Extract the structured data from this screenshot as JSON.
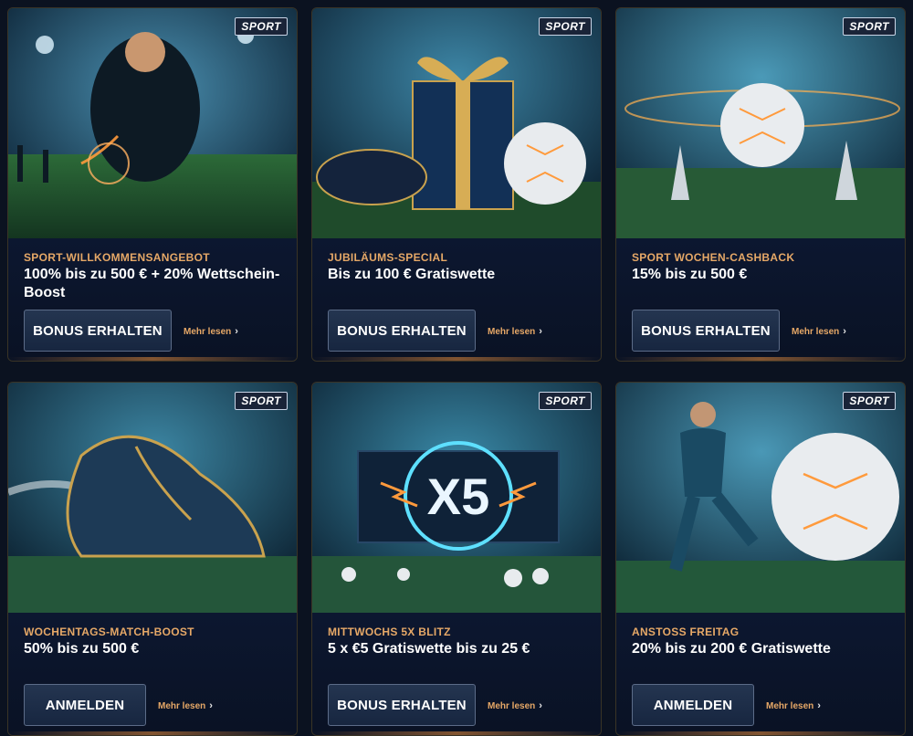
{
  "cards": [
    {
      "badge": "SPORT",
      "subtitle": "SPORT-WILLKOMMENSANGEBOT",
      "title": "100% bis zu 500 € + 20% Wettschein-Boost",
      "button": "BONUS ERHALTEN",
      "more": "Mehr lesen",
      "more_icon": "chevron-right-icon"
    },
    {
      "badge": "SPORT",
      "subtitle": "JUBILÄUMS-SPECIAL",
      "title": "Bis zu 100 € Gratiswette",
      "button": "BONUS ERHALTEN",
      "more": "Mehr lesen",
      "more_icon": "chevron-right-icon"
    },
    {
      "badge": "SPORT",
      "subtitle": "SPORT WOCHEN-CASHBACK",
      "title": "15% bis zu 500 €",
      "button": "BONUS ERHALTEN",
      "more": "Mehr lesen",
      "more_icon": "chevron-right-icon"
    },
    {
      "badge": "SPORT",
      "subtitle": "WOCHENTAGS-MATCH-BOOST",
      "title": "50% bis zu 500 €",
      "button": "ANMELDEN",
      "more": "Mehr lesen",
      "more_icon": "chevron-right-icon"
    },
    {
      "badge": "SPORT",
      "subtitle": "MITTWOCHS 5X BLITZ",
      "title": "5 x €5 Gratiswette bis zu 25 €",
      "button": "BONUS ERHALTEN",
      "more": "Mehr lesen",
      "more_icon": "chevron-right-icon",
      "image_text": "X5"
    },
    {
      "badge": "SPORT",
      "subtitle": "ANSTOSS FREITAG",
      "title": "20% bis zu 200 € Gratiswette",
      "button": "ANMELDEN",
      "more": "Mehr lesen",
      "more_icon": "chevron-right-icon"
    }
  ],
  "colors": {
    "accent": "#e6a867",
    "background": "#0b1220",
    "button": "#1e2e48",
    "badge_border": "#c9d4e6"
  }
}
